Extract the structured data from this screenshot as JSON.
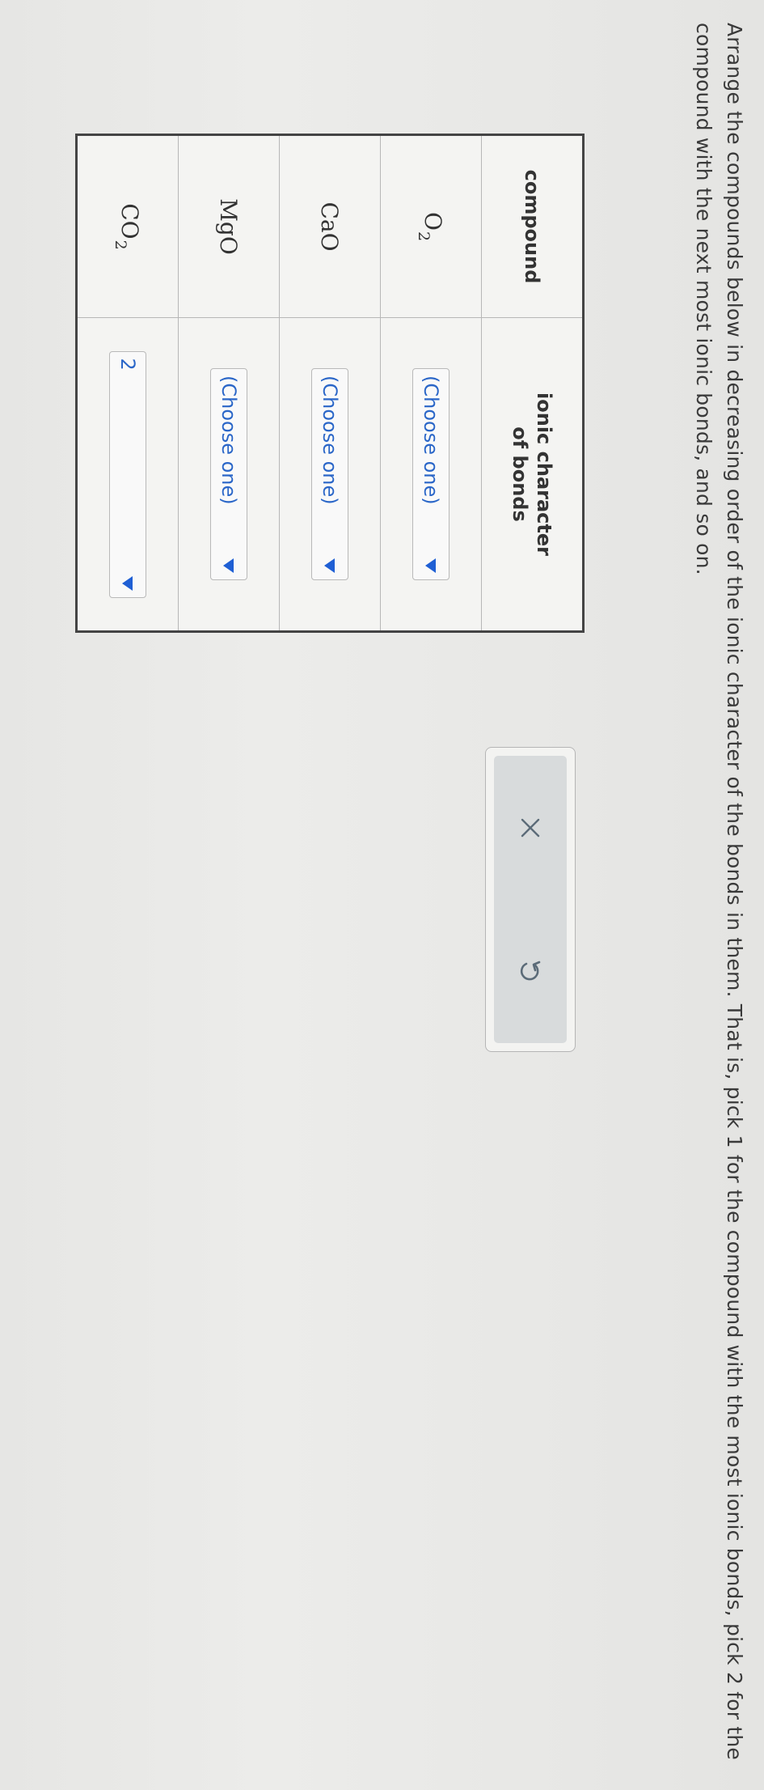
{
  "instructions": "Arrange the compounds below in decreasing order of the ionic character of the bonds in them. That is, pick 1 for the compound with the most ionic bonds, pick 2 for the compound with the next most ionic bonds, and so on.",
  "table": {
    "headers": {
      "compound": "compound",
      "ionic_line1": "ionic character",
      "ionic_line2": "of bonds"
    },
    "rows": [
      {
        "element": "O",
        "subscript": "2",
        "selection": "(Choose one)"
      },
      {
        "element": "CaO",
        "subscript": "",
        "selection": "(Choose one)"
      },
      {
        "element": "MgO",
        "subscript": "",
        "selection": "(Choose one)"
      },
      {
        "element": "CO",
        "subscript": "2",
        "selection": "2"
      }
    ]
  },
  "tools": {
    "clear_icon": "x-icon",
    "reset_icon": "undo-icon"
  },
  "colors": {
    "dropdown_text": "#2a66c8",
    "caret": "#1f5fd4",
    "panel_inner": "#d8dbdc"
  }
}
